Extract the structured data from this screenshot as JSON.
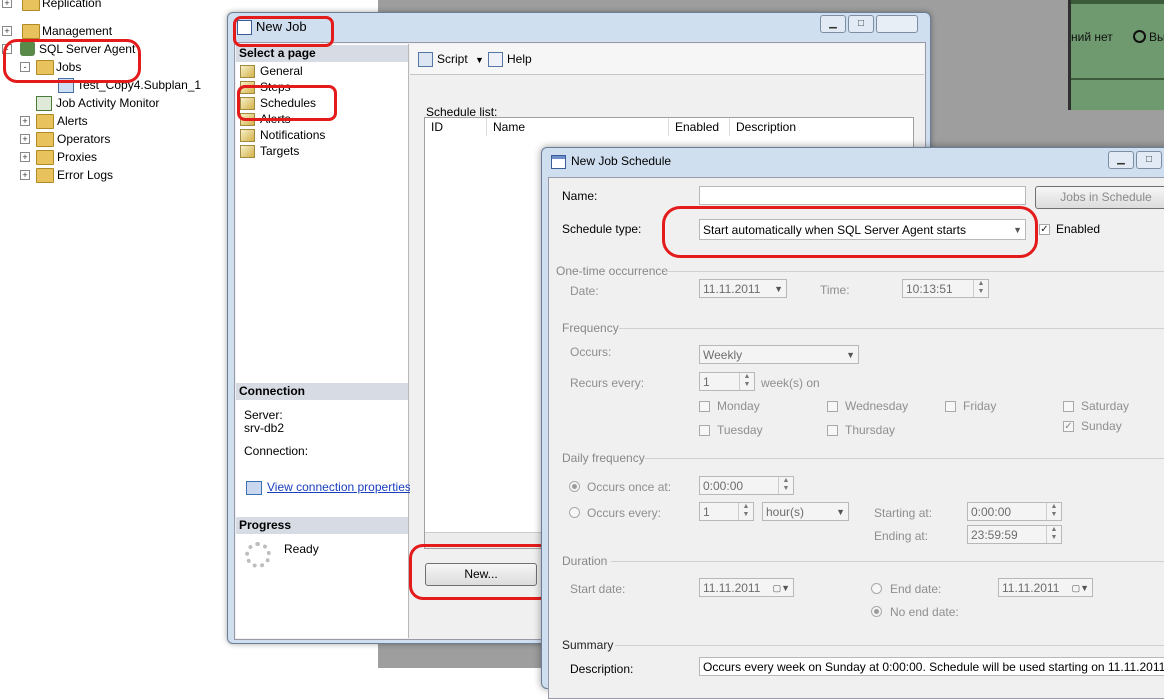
{
  "tree": {
    "items": [
      {
        "label": "Replication",
        "expander": "+",
        "indent": 0
      },
      {
        "label": "Management",
        "expander": "+",
        "indent": 0
      },
      {
        "label": "SQL Server Agent",
        "expander": "-",
        "indent": 0
      },
      {
        "label": "Jobs",
        "expander": "-",
        "indent": 1
      },
      {
        "label": "Test_Copy4.Subplan_1",
        "expander": "",
        "indent": 2
      },
      {
        "label": "Job Activity Monitor",
        "expander": "",
        "indent": 1
      },
      {
        "label": "Alerts",
        "expander": "+",
        "indent": 1
      },
      {
        "label": "Operators",
        "expander": "+",
        "indent": 1
      },
      {
        "label": "Proxies",
        "expander": "+",
        "indent": 1
      },
      {
        "label": "Error Logs",
        "expander": "+",
        "indent": 1
      }
    ]
  },
  "background": {
    "snippet1": "ний нет",
    "snippet2": "Вых"
  },
  "new_job": {
    "title": "New Job",
    "select_page_header": "Select a page",
    "pages": [
      "General",
      "Steps",
      "Schedules",
      "Alerts",
      "Notifications",
      "Targets"
    ],
    "connection_header": "Connection",
    "server_label": "Server:",
    "server_value": "srv-db2",
    "connection_label": "Connection:",
    "view_connection_link": "View connection properties",
    "progress_header": "Progress",
    "progress_status": "Ready",
    "toolbar": {
      "script": "Script",
      "help": "Help"
    },
    "schedule_list_label": "Schedule list:",
    "columns": [
      "ID",
      "Name",
      "Enabled",
      "Description"
    ],
    "new_button": "New..."
  },
  "schedule_dialog": {
    "title": "New Job Schedule",
    "name_label": "Name:",
    "name_value": "",
    "jobs_in_schedule_button": "Jobs in Schedule",
    "schedule_type_label": "Schedule type:",
    "schedule_type_value": "Start automatically when SQL Server Agent starts",
    "enabled_label": "Enabled",
    "enabled_checked": true,
    "one_time": {
      "group": "One-time occurrence",
      "date_label": "Date:",
      "date_value": "11.11.2011",
      "time_label": "Time:",
      "time_value": "10:13:51"
    },
    "frequency": {
      "group": "Frequency",
      "occurs_label": "Occurs:",
      "occurs_value": "Weekly",
      "recurs_label": "Recurs every:",
      "recurs_value": "1",
      "recurs_unit": "week(s) on",
      "days": [
        {
          "label": "Monday",
          "checked": false
        },
        {
          "label": "Wednesday",
          "checked": false
        },
        {
          "label": "Friday",
          "checked": false
        },
        {
          "label": "Saturday",
          "checked": false
        },
        {
          "label": "Tuesday",
          "checked": false
        },
        {
          "label": "Thursday",
          "checked": false
        },
        {
          "label": "Sunday",
          "checked": true
        }
      ]
    },
    "daily": {
      "group": "Daily frequency",
      "once_label": "Occurs once at:",
      "once_value": "0:00:00",
      "every_label": "Occurs every:",
      "every_value": "1",
      "every_unit": "hour(s)",
      "starting_label": "Starting at:",
      "starting_value": "0:00:00",
      "ending_label": "Ending at:",
      "ending_value": "23:59:59"
    },
    "duration": {
      "group": "Duration",
      "start_label": "Start date:",
      "start_value": "11.11.2011",
      "end_label": "End date:",
      "end_value": "11.11.2011",
      "no_end_label": "No end date:"
    },
    "summary": {
      "group": "Summary",
      "description_label": "Description:",
      "description_value": "Occurs every week on Sunday at 0:00:00. Schedule will be used starting on 11.11.2011."
    }
  },
  "colors": {
    "highlight": "#e31b1b",
    "window_frame": "#cfdff0",
    "link": "#1a3fbf"
  }
}
